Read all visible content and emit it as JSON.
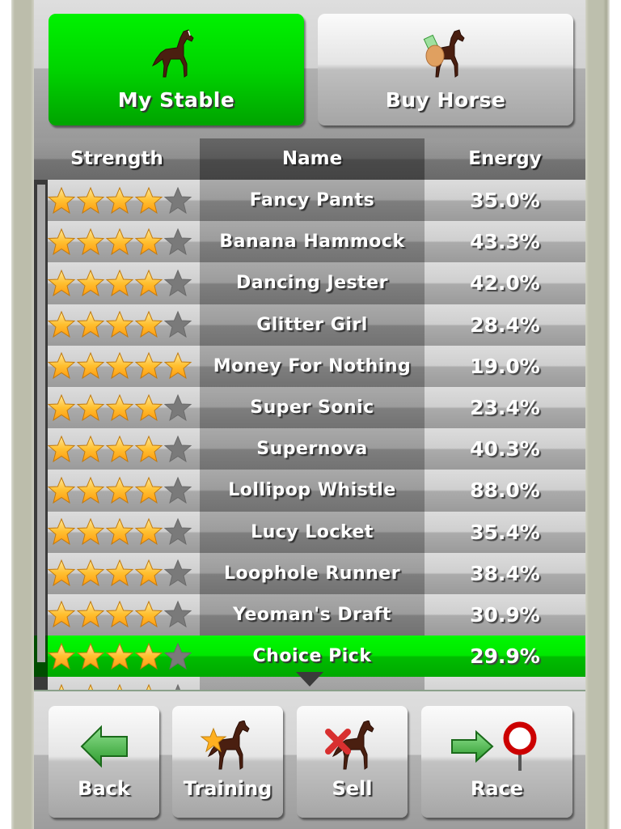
{
  "tabs": [
    {
      "label": "My Stable",
      "icon": "horse-icon",
      "active": true
    },
    {
      "label": "Buy Horse",
      "icon": "buy-horse-icon",
      "active": false
    }
  ],
  "table": {
    "columns": [
      "Strength",
      "Name",
      "Energy"
    ],
    "max_stars": 5,
    "rows": [
      {
        "stars": 4,
        "name": "Fancy Pants",
        "energy": "35.0%"
      },
      {
        "stars": 4,
        "name": "Banana Hammock",
        "energy": "43.3%"
      },
      {
        "stars": 4,
        "name": "Dancing Jester",
        "energy": "42.0%"
      },
      {
        "stars": 4,
        "name": "Glitter Girl",
        "energy": "28.4%"
      },
      {
        "stars": 5,
        "name": "Money For Nothing",
        "energy": "19.0%"
      },
      {
        "stars": 4,
        "name": "Super Sonic",
        "energy": "23.4%"
      },
      {
        "stars": 4,
        "name": "Supernova",
        "energy": "40.3%"
      },
      {
        "stars": 4,
        "name": "Lollipop Whistle",
        "energy": "88.0%"
      },
      {
        "stars": 4,
        "name": "Lucy Locket",
        "energy": "35.4%"
      },
      {
        "stars": 4,
        "name": "Loophole Runner",
        "energy": "38.4%"
      },
      {
        "stars": 4,
        "name": "Yeoman's Draft",
        "energy": "30.9%"
      },
      {
        "stars": 4,
        "name": "Choice Pick",
        "energy": "29.9%",
        "selected": true
      },
      {
        "stars": 4,
        "name": "",
        "energy": ""
      }
    ]
  },
  "bottom_buttons": [
    {
      "label": "Back",
      "icon": "back-arrow-icon"
    },
    {
      "label": "Training",
      "icon": "training-icon"
    },
    {
      "label": "Sell",
      "icon": "sell-icon"
    },
    {
      "label": "Race",
      "icon": "race-icon"
    }
  ],
  "colors": {
    "active_green": "#00d400",
    "star_gold": "#ffb020",
    "star_empty": "#7a7a7a"
  }
}
